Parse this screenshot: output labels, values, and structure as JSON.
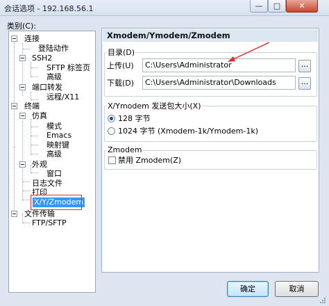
{
  "window": {
    "title": "会话选项 - 192.168.56.1"
  },
  "titlebar": {
    "min_glyph": "—",
    "max_glyph": "□",
    "close_glyph": "✕"
  },
  "category": {
    "label": "类别(C):",
    "tree": [
      "连接",
      "登陆动作",
      "SSH2",
      "SFTP 标签页",
      "高级",
      "端口转发",
      "远程/X11",
      "终端",
      "仿真",
      "模式",
      "Emacs",
      "映射键",
      "高级",
      "外观",
      "窗口",
      "日志文件",
      "打印",
      "X/Y/Zmodem",
      "文件传输",
      "FTP/SFTP"
    ]
  },
  "panel": {
    "header": "Xmodem/Ymodem/Zmodem",
    "directory": {
      "title": "目录(D)",
      "upload_label": "上传(U)",
      "upload_value": "C:\\Users\\Administrator",
      "download_label": "下载(D)",
      "download_value": "C:\\Users\\Administrator\\Downloads",
      "browse_label": "..."
    },
    "packet": {
      "title": "X/Ymodem 发送包大小(X)",
      "option_128": "128 字节",
      "option_1024": "1024 字节 (Xmodem-1k/Ymodem-1k)",
      "selected": "128 字节"
    },
    "zmodem": {
      "title": "Zmodem",
      "disable_label": "禁用 Zmodem(Z)",
      "checked": false
    }
  },
  "buttons": {
    "ok": "确定",
    "cancel": "取消"
  },
  "colors": {
    "annotation": "#e03030",
    "selection": "#3399ff"
  }
}
